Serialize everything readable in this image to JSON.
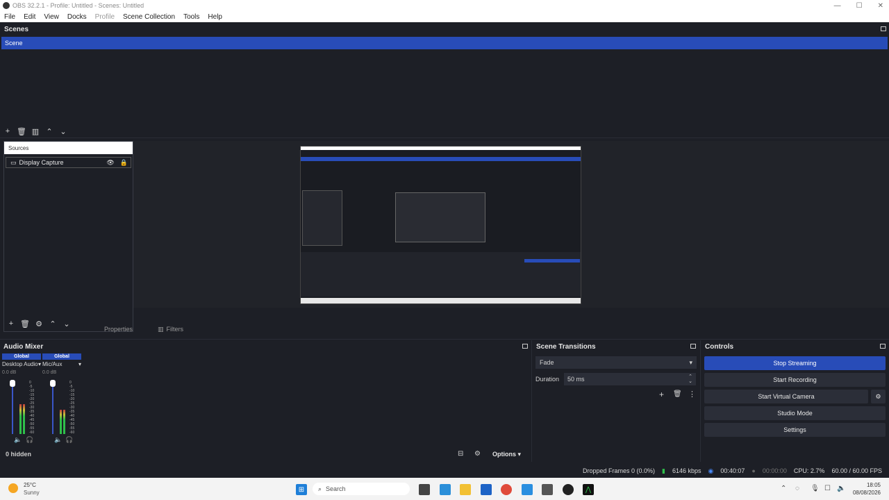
{
  "window": {
    "title": "OBS 32.2.1 - Profile: Untitled - Scenes: Untitled"
  },
  "menu": [
    "File",
    "Edit",
    "View",
    "Docks",
    "Profile",
    "Scene Collection",
    "Tools",
    "Help"
  ],
  "scenes": {
    "header": "Scenes",
    "items": [
      "Scene"
    ]
  },
  "sources": {
    "header": "Sources",
    "items": [
      {
        "label": "Display Capture"
      }
    ]
  },
  "source_tabs": {
    "properties": "Properties",
    "filters": "Filters"
  },
  "audio_mixer": {
    "header": "Audio Mixer",
    "channels": [
      {
        "global": "Global",
        "name": "Desktop Audio",
        "db": "0.0 dB",
        "level": 0.55
      },
      {
        "global": "Global",
        "name": "Mic/Aux",
        "db": "0.0 dB",
        "level": 0.45
      }
    ],
    "scale": [
      "0",
      "-5",
      "-10",
      "-15",
      "-20",
      "-25",
      "-30",
      "-35",
      "-40",
      "-45",
      "-50",
      "-55",
      "-60"
    ],
    "hidden_label": "0 hidden",
    "options_label": "Options"
  },
  "scene_transitions": {
    "header": "Scene Transitions",
    "selected": "Fade",
    "duration_label": "Duration",
    "duration_value": "50 ms"
  },
  "controls": {
    "header": "Controls",
    "stop_streaming": "Stop Streaming",
    "start_recording": "Start Recording",
    "start_virtual_camera": "Start Virtual Camera",
    "studio_mode": "Studio Mode",
    "settings": "Settings"
  },
  "status": {
    "dropped_frames": "Dropped Frames 0 (0.0%)",
    "bitrate": "6146 kbps",
    "stream_time": "00:40:07",
    "record_time": "00:00:00",
    "cpu": "CPU: 2.7%",
    "fps": "60.00 / 60.00 FPS"
  },
  "taskbar": {
    "weather_temp": "25°C",
    "weather_desc": "Sunny",
    "search_label": "Search",
    "time": "18:05",
    "date": "08/08/2026"
  },
  "colors": {
    "accent": "#284cb8",
    "background": "#1d1f26"
  }
}
